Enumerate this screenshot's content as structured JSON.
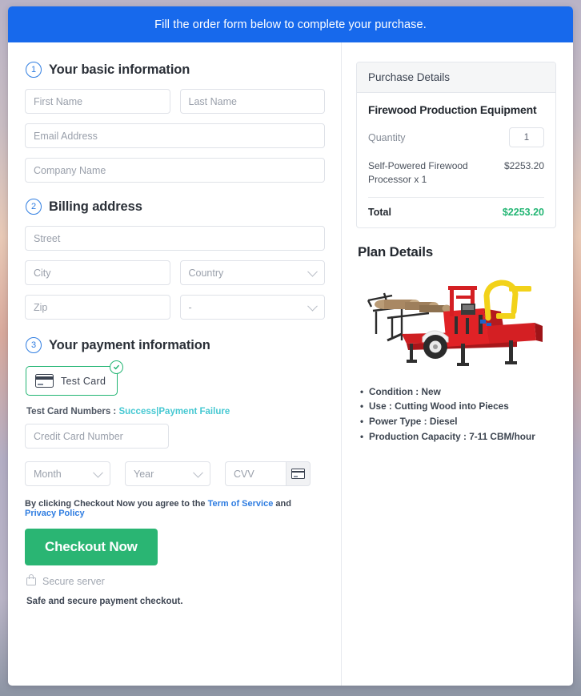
{
  "banner": {
    "text": "Fill the order form below to complete your purchase."
  },
  "sections": {
    "basic": {
      "number": "1",
      "title": "Your basic information",
      "first_name_placeholder": "First Name",
      "last_name_placeholder": "Last Name",
      "email_placeholder": "Email Address",
      "company_placeholder": "Company Name"
    },
    "billing": {
      "number": "2",
      "title": "Billing address",
      "street_placeholder": "Street",
      "city_placeholder": "City",
      "country_placeholder": "Country",
      "zip_placeholder": "Zip",
      "state_placeholder": "-"
    },
    "payment": {
      "number": "3",
      "title": "Your payment information",
      "tile_label": "Test Card",
      "test_numbers_label": "Test Card Numbers :",
      "success_link": "Success",
      "separator": "|",
      "failure_link": "Payment Failure",
      "card_number_placeholder": "Credit Card Number",
      "month_placeholder": "Month",
      "year_placeholder": "Year",
      "cvv_placeholder": "CVV",
      "terms_prefix": "By clicking Checkout Now you agree to the",
      "terms_link": "Term of Service",
      "terms_and": "and",
      "privacy_link": "Privacy Policy",
      "checkout_label": "Checkout Now",
      "secure_server": "Secure server",
      "safe_note": "Safe and secure payment checkout."
    }
  },
  "purchase": {
    "header": "Purchase Details",
    "product_title": "Firewood Production Equipment",
    "quantity_label": "Quantity",
    "quantity_value": "1",
    "line_item_name": "Self-Powered Firewood Processor x 1",
    "line_item_price": "$2253.20",
    "total_label": "Total",
    "total_value": "$2253.20"
  },
  "plan": {
    "title": "Plan Details",
    "specs": [
      "Condition : New",
      "Use : Cutting Wood into Pieces",
      "Power Type : Diesel",
      "Production Capacity : 7-11 CBM/hour"
    ]
  },
  "colors": {
    "banner_blue": "#1769ec",
    "accent_green": "#22b573",
    "link_blue": "#2f7de1",
    "link_teal": "#46c8d2"
  }
}
